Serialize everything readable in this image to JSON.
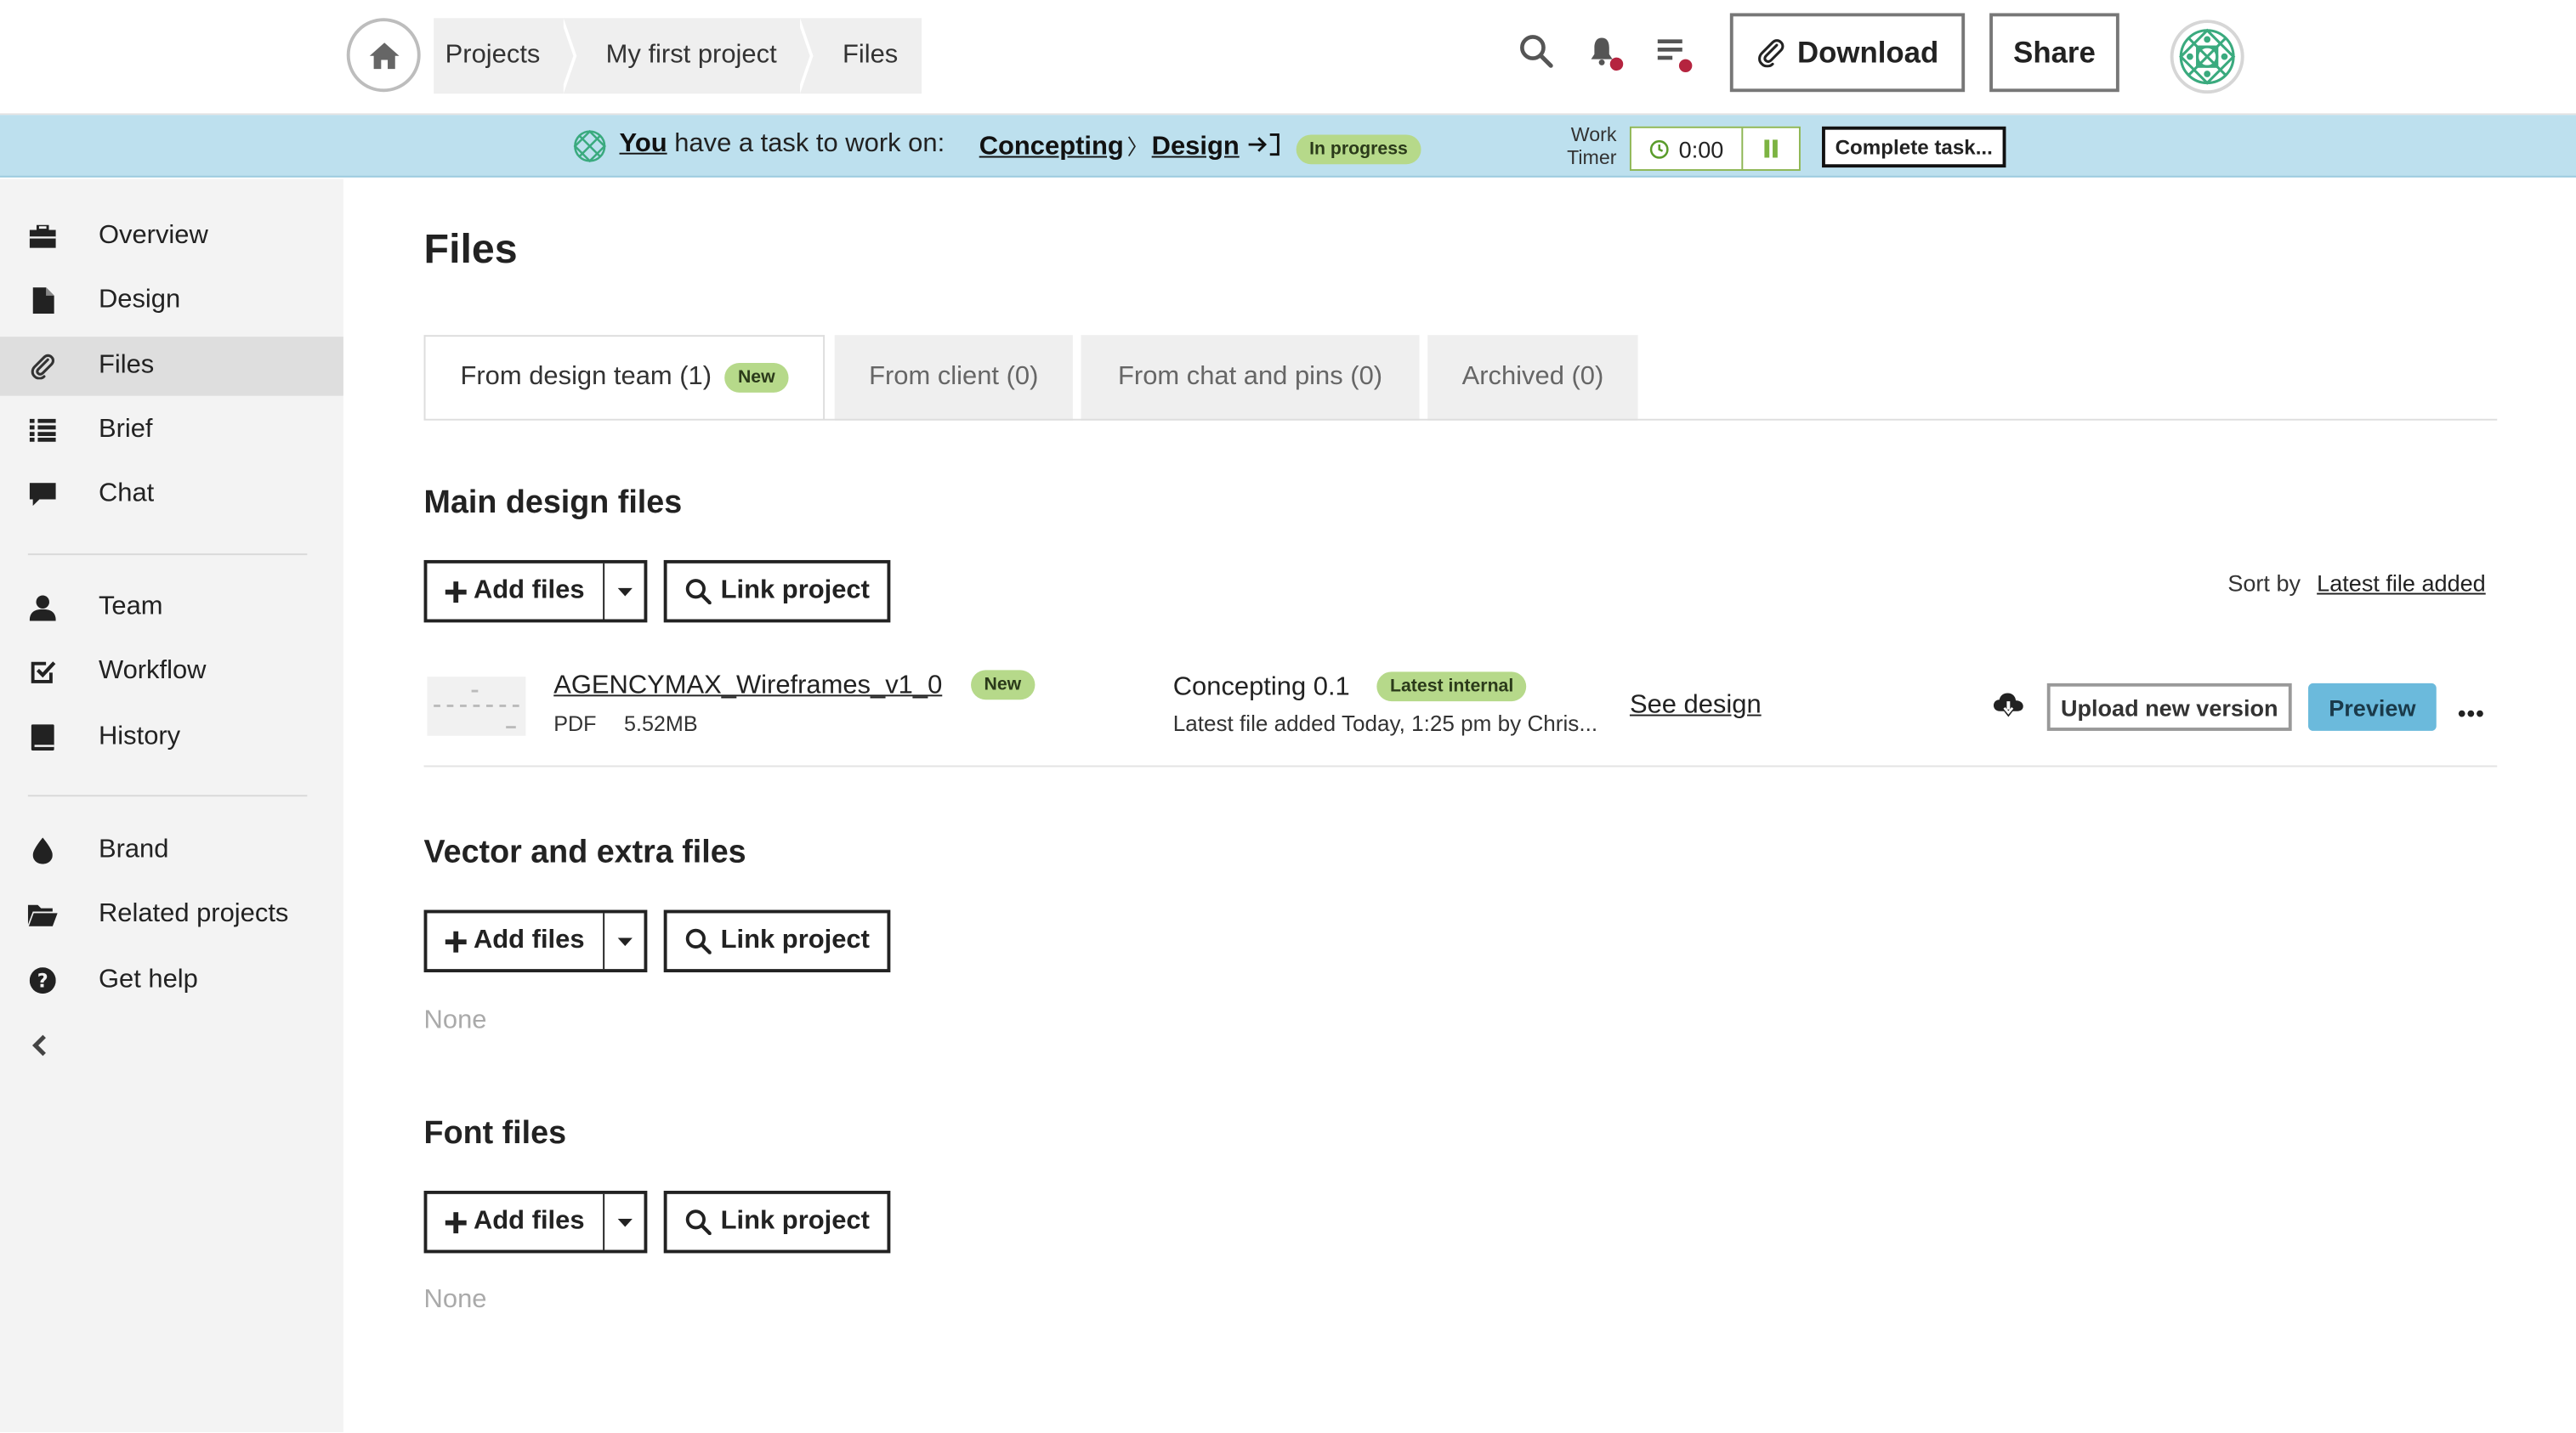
{
  "breadcrumbs": [
    "Projects",
    "My first project",
    "Files"
  ],
  "header": {
    "download_label": "Download",
    "share_label": "Share"
  },
  "task_banner": {
    "you": "You",
    "text": "have a task to work on:",
    "stage": "Concepting",
    "separator": "〉",
    "step": "Design",
    "status": "In progress",
    "timer_label_1": "Work",
    "timer_label_2": "Timer",
    "timer_value": "0:00",
    "complete_label": "Complete task..."
  },
  "sidebar": {
    "items": [
      {
        "label": "Overview",
        "icon": "briefcase-icon"
      },
      {
        "label": "Design",
        "icon": "file-icon"
      },
      {
        "label": "Files",
        "icon": "paperclip-icon",
        "active": true
      },
      {
        "label": "Brief",
        "icon": "list-icon"
      },
      {
        "label": "Chat",
        "icon": "chat-icon"
      },
      {
        "label": "Team",
        "icon": "user-icon"
      },
      {
        "label": "Workflow",
        "icon": "checkbox-icon"
      },
      {
        "label": "History",
        "icon": "book-icon"
      },
      {
        "label": "Brand",
        "icon": "drop-icon"
      },
      {
        "label": "Related projects",
        "icon": "folder-open-icon"
      },
      {
        "label": "Get help",
        "icon": "question-icon"
      }
    ]
  },
  "main": {
    "title": "Files",
    "tabs": [
      {
        "label": "From design team (1)",
        "badge": "New"
      },
      {
        "label": "From client (0)"
      },
      {
        "label": "From chat and pins (0)"
      },
      {
        "label": "Archived (0)"
      }
    ],
    "add_files_label": "Add files",
    "link_project_label": "Link project",
    "sort_by_label": "Sort by",
    "sort_by_value": "Latest file added",
    "sections": [
      {
        "title": "Main design files"
      },
      {
        "title": "Vector and extra files",
        "empty": "None"
      },
      {
        "title": "Font files",
        "empty": "None"
      }
    ],
    "file": {
      "name": "AGENCYMAX_Wireframes_v1_0",
      "badge": "New",
      "type": "PDF",
      "size": "5.52MB",
      "stage": "Concepting 0.1",
      "stage_badge": "Latest internal",
      "added": "Latest file added Today, 1:25 pm by Chris...",
      "see_design": "See design",
      "upload_label": "Upload new version",
      "preview_label": "Preview"
    }
  },
  "colors": {
    "banner": "#bde0ee",
    "badge_green": "#b6d98a",
    "preview_blue": "#6bbadc",
    "sidebar_bg": "#f3f3f3"
  }
}
